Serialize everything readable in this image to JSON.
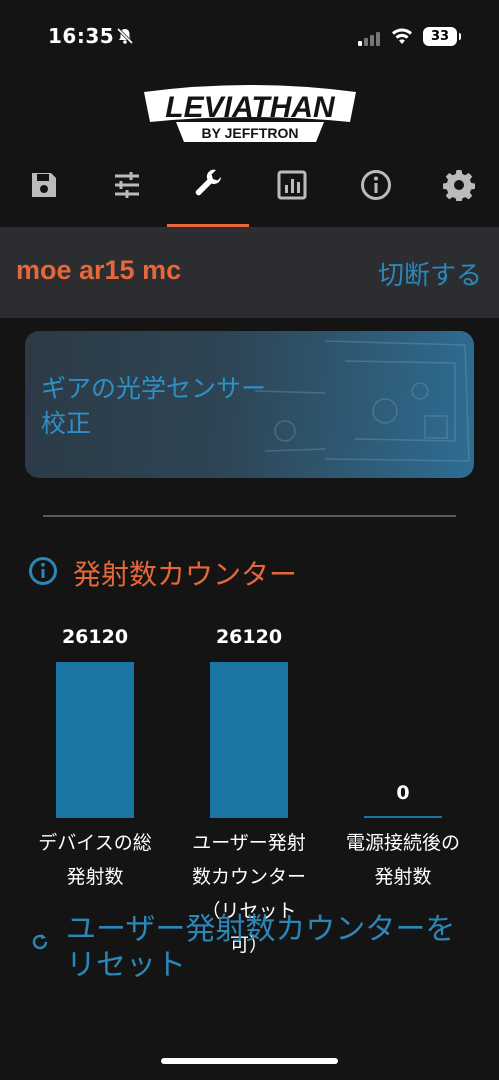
{
  "status_bar": {
    "time": "16:35",
    "battery": "33"
  },
  "app": {
    "logo_main": "LEVIATHAN",
    "logo_sub": "BY JEFFTRON"
  },
  "toolbar": {
    "tabs": [
      {
        "icon": "save-icon"
      },
      {
        "icon": "sliders-icon"
      },
      {
        "icon": "wrench-icon",
        "active": true
      },
      {
        "icon": "stats-icon"
      },
      {
        "icon": "info-icon"
      },
      {
        "icon": "gear-icon"
      }
    ]
  },
  "device": {
    "name": "moe ar15 mc",
    "disconnect_label": "切断する"
  },
  "calibration": {
    "title_line1": "ギアの光学センサー",
    "title_line2": "校正"
  },
  "shot_counter": {
    "title": "発射数カウンター",
    "reset_label_line1": "ユーザー発射数カウンターを",
    "reset_label_line2": "リセット"
  },
  "chart_data": {
    "type": "bar",
    "categories": [
      "デバイスの総発射数",
      "ユーザー発射数カウンター（リセット可）",
      "電源接続後の発射数"
    ],
    "category_lines": [
      [
        "デバイスの総",
        "発射数"
      ],
      [
        "ユーザー発射",
        "数カウンター",
        "（リセット",
        "可）"
      ],
      [
        "電源接続後の",
        "発射数"
      ]
    ],
    "values": [
      26120,
      26120,
      0
    ],
    "value_labels": [
      "26120",
      "26120",
      "0"
    ],
    "ylim": [
      0,
      26120
    ],
    "bar_color": "#1b76a6",
    "grid": false
  },
  "colors": {
    "accent": "#e5673a",
    "link": "#2b87b8",
    "bar": "#1b76a6"
  }
}
